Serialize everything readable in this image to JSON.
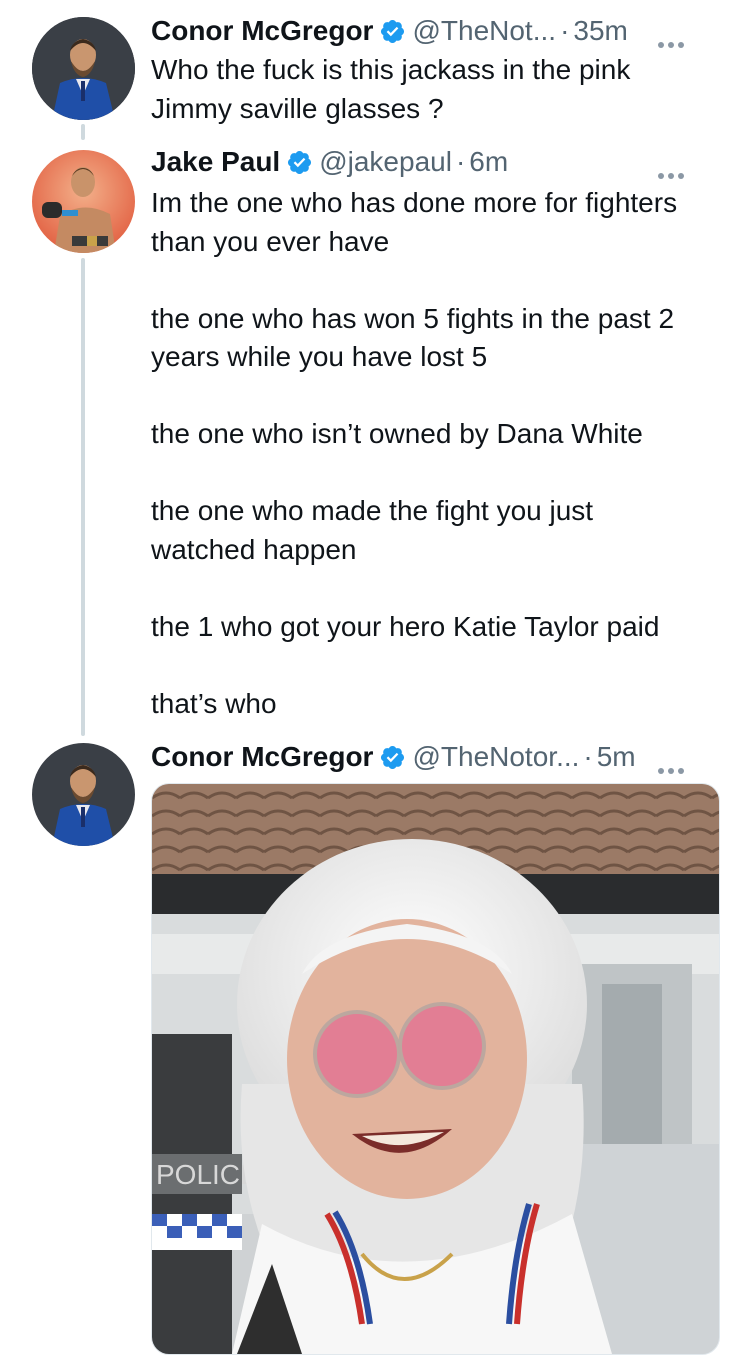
{
  "tweets": [
    {
      "name": "Conor McGregor",
      "handle": "@TheNot...",
      "time": "35m",
      "text": "Who the fuck is this jackass in the pink\nJimmy saville glasses ?",
      "verified": true
    },
    {
      "name": "Jake Paul",
      "handle": "@jakepaul",
      "time": "6m",
      "text": "Im the one who has done more for fighters\nthan you ever have\n\nthe one who has won 5 fights in the past 2\nyears while you have lost 5\n\nthe one who isn’t owned by Dana White\n\nthe one who made the fight you just\nwatched happen\n\nthe 1 who got your hero Katie Taylor paid\n\nthat’s who",
      "verified": true
    },
    {
      "name": "Conor McGregor",
      "handle": "@TheNotor...",
      "time": "5m",
      "text": "",
      "verified": true,
      "media_sign_text": "POLICE"
    }
  ],
  "separator": "·",
  "icons": {
    "verified": "verified-badge-icon",
    "more": "more-options-icon"
  },
  "colors": {
    "verified": "#1d9bf0",
    "text": "#0f1419",
    "secondary": "#536471",
    "thread_line": "#cfd9de"
  }
}
